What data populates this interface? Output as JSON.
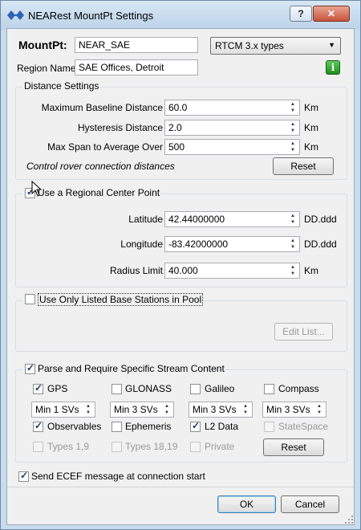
{
  "window": {
    "title": "NEARest MountPt Settings",
    "help_label": "?",
    "close_label": "✕"
  },
  "header": {
    "mountpt_label": "MountPt:",
    "mountpt_value": "NEAR_SAE",
    "type_select": "RTCM 3.x types",
    "region_label": "Region Name:",
    "region_value": "SAE Offices, Detroit",
    "info_label": "i"
  },
  "distance": {
    "title": "Distance Settings",
    "rows": [
      {
        "label": "Maximum Baseline Distance",
        "value": "60.0",
        "unit": "Km"
      },
      {
        "label": "Hysteresis Distance",
        "value": "2.0",
        "unit": "Km"
      },
      {
        "label": "Max Span to Average Over",
        "value": "500",
        "unit": "Km"
      }
    ],
    "note": "Control rover connection distances",
    "reset_label": "Reset"
  },
  "regional": {
    "checkbox_label": "Use a Regional Center Point",
    "checked": true,
    "rows": [
      {
        "label": "Latitude",
        "value": "42.44000000",
        "unit": "DD.ddd"
      },
      {
        "label": "Longitude",
        "value": "-83.42000000",
        "unit": "DD.ddd"
      },
      {
        "label": "Radius Limit",
        "value": "40.000",
        "unit": "Km"
      }
    ]
  },
  "pool": {
    "checkbox_label": "Use Only Listed Base Stations in Pool",
    "checked": false,
    "edit_label": "Edit List..."
  },
  "stream": {
    "checkbox_label": "Parse and Require Specific Stream Content",
    "checked": true,
    "systems": [
      {
        "label": "GPS",
        "checked": true,
        "svs": "Min 1 SVs"
      },
      {
        "label": "GLONASS",
        "checked": false,
        "svs": "Min 3 SVs"
      },
      {
        "label": "Galileo",
        "checked": false,
        "svs": "Min 3 SVs"
      },
      {
        "label": "Compass",
        "checked": false,
        "svs": "Min 3 SVs"
      }
    ],
    "content": [
      {
        "label": "Observables",
        "checked": true,
        "enabled": true
      },
      {
        "label": "Ephemeris",
        "checked": false,
        "enabled": true
      },
      {
        "label": "L2 Data",
        "checked": true,
        "enabled": true
      },
      {
        "label": "StateSpace",
        "checked": false,
        "enabled": false
      }
    ],
    "types": [
      {
        "label": "Types 1,9",
        "enabled": false
      },
      {
        "label": "Types 18,19",
        "enabled": false
      },
      {
        "label": "Private",
        "enabled": false
      }
    ],
    "reset_label": "Reset"
  },
  "ecef": {
    "checkbox_label": "Send ECEF message at connection start",
    "checked": true
  },
  "footer": {
    "ok_label": "OK",
    "cancel_label": "Cancel"
  }
}
